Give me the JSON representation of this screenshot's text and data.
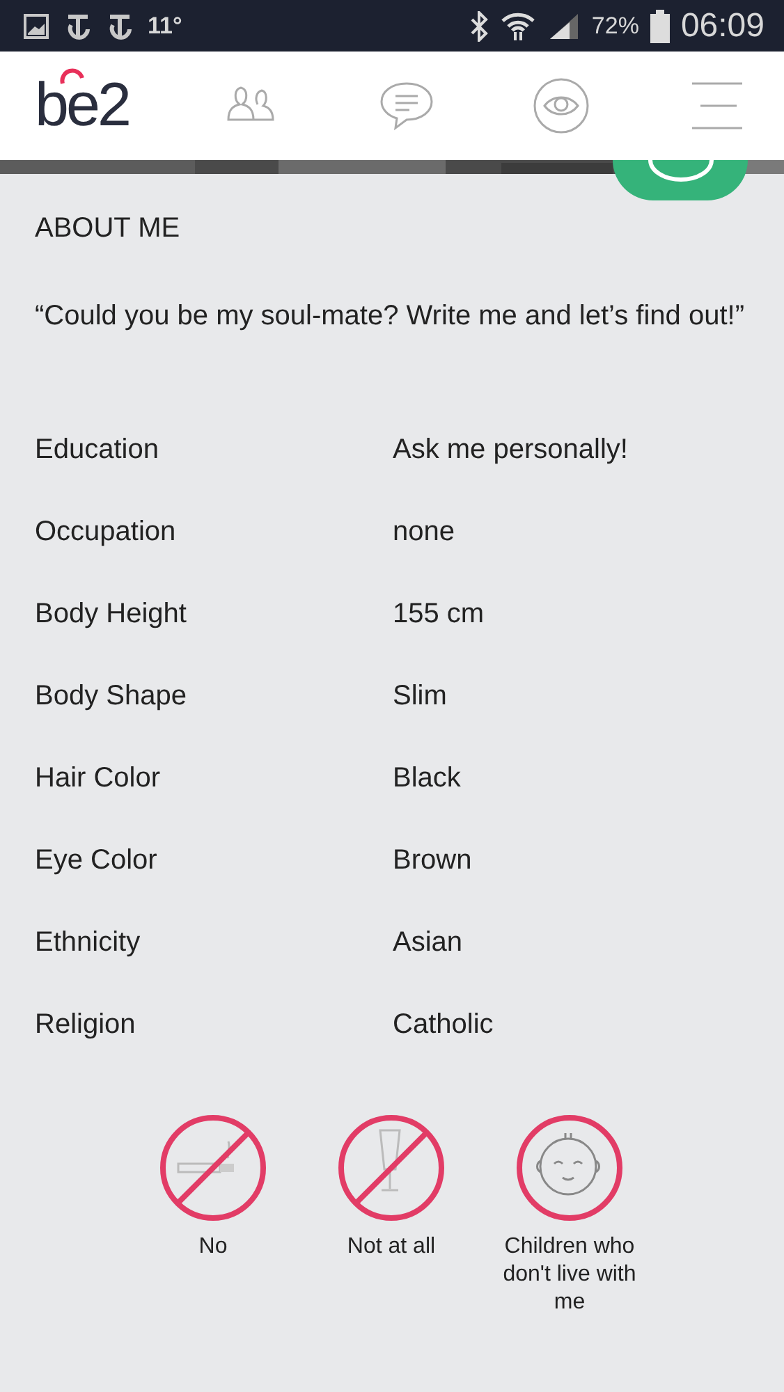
{
  "status_bar": {
    "temperature": "11°",
    "battery": "72%",
    "time": "06:09"
  },
  "nav": {
    "logo": "be2",
    "tabs": [
      {
        "kind": "contacts",
        "selected": false
      },
      {
        "kind": "messages",
        "selected": false
      },
      {
        "kind": "visitors",
        "selected": false
      },
      {
        "kind": "menu",
        "selected": false
      }
    ]
  },
  "about": {
    "heading": "ABOUT ME",
    "quote": "“Could you be my soul-mate? Write me and let’s find out!”"
  },
  "details": [
    {
      "label": "Education",
      "value": "Ask me personally!"
    },
    {
      "label": "Occupation",
      "value": "none"
    },
    {
      "label": "Body Height",
      "value": "155 cm"
    },
    {
      "label": "Body Shape",
      "value": "Slim"
    },
    {
      "label": "Hair Color",
      "value": "Black"
    },
    {
      "label": "Eye Color",
      "value": "Brown"
    },
    {
      "label": "Ethnicity",
      "value": "Asian"
    },
    {
      "label": "Religion",
      "value": "Catholic"
    }
  ],
  "habits": [
    {
      "kind": "smoking",
      "crossed": true,
      "label": "No"
    },
    {
      "kind": "drinking",
      "crossed": true,
      "label": "Not at all"
    },
    {
      "kind": "children",
      "crossed": false,
      "label": "Children who don't live with me"
    }
  ]
}
